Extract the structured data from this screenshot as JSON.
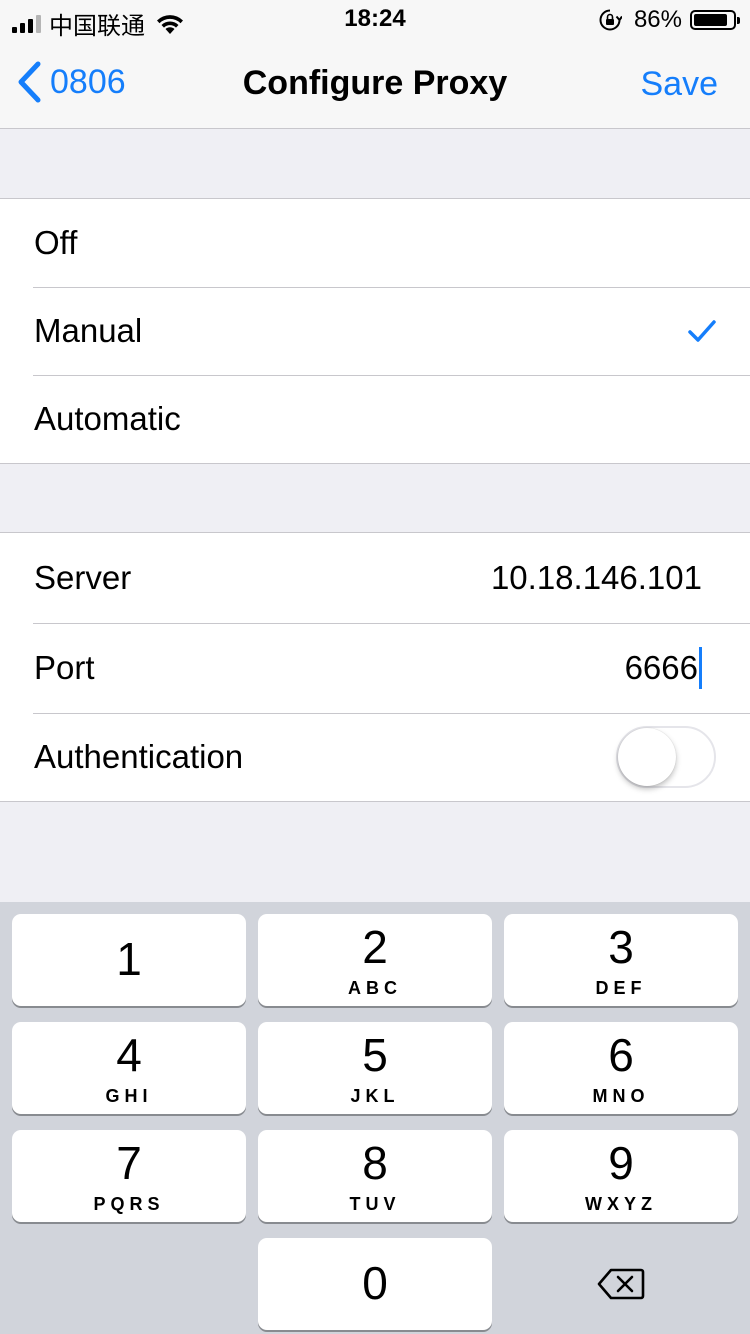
{
  "status_bar": {
    "carrier": "中国联通",
    "time": "18:24",
    "battery_percent": "86%",
    "battery_level": 0.86,
    "icons": [
      "signal-icon",
      "wifi-icon",
      "orientation-lock-icon",
      "battery-icon"
    ]
  },
  "nav": {
    "back_label": "0806",
    "title": "Configure Proxy",
    "save_label": "Save"
  },
  "proxy_modes": [
    {
      "label": "Off",
      "selected": false
    },
    {
      "label": "Manual",
      "selected": true
    },
    {
      "label": "Automatic",
      "selected": false
    }
  ],
  "manual_settings": {
    "server_label": "Server",
    "server_value": "10.18.146.101",
    "port_label": "Port",
    "port_value": "6666",
    "auth_label": "Authentication",
    "auth_enabled": false
  },
  "keypad": {
    "keys": [
      {
        "digit": "1",
        "letters": ""
      },
      {
        "digit": "2",
        "letters": "ABC"
      },
      {
        "digit": "3",
        "letters": "DEF"
      },
      {
        "digit": "4",
        "letters": "GHI"
      },
      {
        "digit": "5",
        "letters": "JKL"
      },
      {
        "digit": "6",
        "letters": "MNO"
      },
      {
        "digit": "7",
        "letters": "PQRS"
      },
      {
        "digit": "8",
        "letters": "TUV"
      },
      {
        "digit": "9",
        "letters": "WXYZ"
      },
      {
        "digit": "0",
        "letters": ""
      }
    ],
    "accent_color": "#157efb"
  }
}
